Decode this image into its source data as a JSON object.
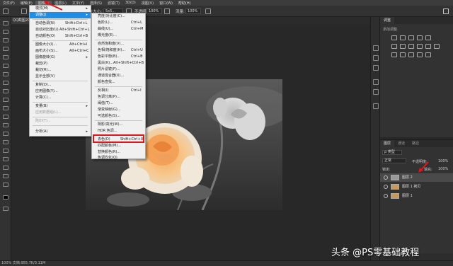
{
  "menubar": {
    "items": [
      "文件(F)",
      "编辑(E)",
      "图像(I)",
      "图层(L)",
      "文字(Y)",
      "选择(S)",
      "滤镜(T)",
      "3D(D)",
      "视图(V)",
      "窗口(W)",
      "帮助(H)"
    ],
    "active_index": 2
  },
  "optbar": {
    "sample_label": "取样大小:",
    "sample_value": "5x5...",
    "opacity_label": "不透明度:",
    "opacity_value": "100%",
    "flow_label": "流量:",
    "flow_value": "100%"
  },
  "document_tab": {
    "title": "QQ截图2020..."
  },
  "image_menu": {
    "items": [
      {
        "label": "模式(M)",
        "shortcut": "",
        "submenu": true,
        "disabled": false
      },
      {
        "label": "调整(J)",
        "shortcut": "",
        "submenu": true,
        "disabled": false,
        "highlighted": true
      },
      {
        "label": "自动色调(N)",
        "shortcut": "Shift+Ctrl+L"
      },
      {
        "label": "自动对比度(U)",
        "shortcut": "Alt+Shift+Ctrl+L"
      },
      {
        "label": "自动颜色(O)",
        "shortcut": "Shift+Ctrl+B"
      },
      {
        "label": "图像大小(I)...",
        "shortcut": "Alt+Ctrl+I"
      },
      {
        "label": "画布大小(S)...",
        "shortcut": "Alt+Ctrl+C"
      },
      {
        "label": "图像旋转(G)",
        "shortcut": "",
        "submenu": true
      },
      {
        "label": "裁剪(P)",
        "shortcut": ""
      },
      {
        "label": "裁切(R)...",
        "shortcut": ""
      },
      {
        "label": "显示全部(V)",
        "shortcut": ""
      },
      {
        "label": "复制(D)...",
        "shortcut": ""
      },
      {
        "label": "应用图像(Y)...",
        "shortcut": ""
      },
      {
        "label": "计算(C)...",
        "shortcut": ""
      },
      {
        "label": "变量(B)",
        "shortcut": "",
        "submenu": true
      },
      {
        "label": "应用数据组(L)...",
        "shortcut": "",
        "disabled": true
      },
      {
        "label": "陷印(T)...",
        "shortcut": "",
        "disabled": true
      },
      {
        "label": "分析(A)",
        "shortcut": "",
        "submenu": true
      }
    ]
  },
  "adjust_menu": {
    "items": [
      {
        "label": "亮度/对比度(C)...",
        "shortcut": ""
      },
      {
        "label": "色阶(L)...",
        "shortcut": "Ctrl+L"
      },
      {
        "label": "曲线(U)...",
        "shortcut": "Ctrl+M"
      },
      {
        "label": "曝光度(E)...",
        "shortcut": ""
      },
      {
        "label": "自然饱和度(V)...",
        "shortcut": ""
      },
      {
        "label": "色相/饱和度(H)...",
        "shortcut": "Ctrl+U"
      },
      {
        "label": "色彩平衡(B)...",
        "shortcut": "Ctrl+B"
      },
      {
        "label": "黑白(K)...",
        "shortcut": "Alt+Shift+Ctrl+B"
      },
      {
        "label": "照片滤镜(F)...",
        "shortcut": ""
      },
      {
        "label": "通道混合器(X)...",
        "shortcut": ""
      },
      {
        "label": "颜色查找...",
        "shortcut": ""
      },
      {
        "label": "反相(I)",
        "shortcut": "Ctrl+I"
      },
      {
        "label": "色调分离(P)...",
        "shortcut": ""
      },
      {
        "label": "阈值(T)...",
        "shortcut": ""
      },
      {
        "label": "渐变映射(G)...",
        "shortcut": ""
      },
      {
        "label": "可选颜色(S)...",
        "shortcut": ""
      },
      {
        "label": "阴影/高光(W)...",
        "shortcut": ""
      },
      {
        "label": "HDR 色调...",
        "shortcut": ""
      },
      {
        "label": "去色(D)",
        "shortcut": "Shift+Ctrl+U"
      },
      {
        "label": "匹配颜色(M)...",
        "shortcut": ""
      },
      {
        "label": "替换颜色(R)...",
        "shortcut": ""
      },
      {
        "label": "色调均化(Q)",
        "shortcut": ""
      }
    ]
  },
  "adjust_panel": {
    "tabs": [
      "调整"
    ],
    "hint": "添加调整"
  },
  "layers_panel": {
    "tabs": [
      "图层",
      "通道",
      "路径"
    ],
    "kind_label": "ρ 类型",
    "blend_mode": "正常",
    "opacity_label": "不透明度:",
    "opacity_value": "100%",
    "lock_label": "锁定:",
    "fill_label": "填充:",
    "fill_value": "100%",
    "layers": [
      {
        "name": "图层 2",
        "active": true
      },
      {
        "name": "图层 1 拷贝",
        "active": false
      },
      {
        "name": "图层 1",
        "active": false
      }
    ]
  },
  "status": {
    "text": "100%    文档:955.7K/3.11M"
  },
  "watermark": {
    "text": "头条 @PS零基础教程"
  },
  "colors": {
    "highlight": "#1e8ee6",
    "annotation_red": "#e0161b"
  }
}
